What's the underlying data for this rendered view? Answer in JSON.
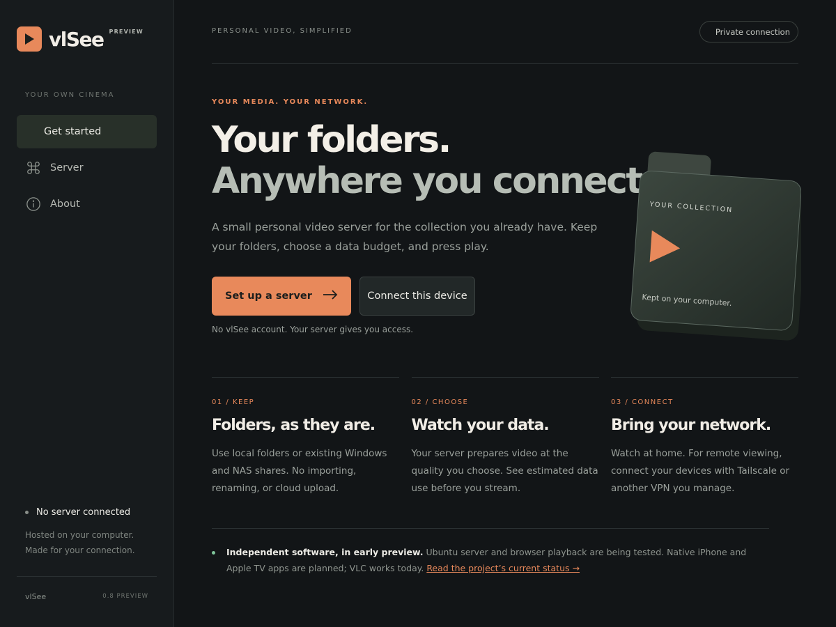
{
  "brand": {
    "name": "vlSee",
    "badge": "PREVIEW",
    "accent": "#e8895b"
  },
  "sidebar": {
    "section_label": "YOUR OWN CINEMA",
    "items": [
      {
        "label": "Get started",
        "icon": "none",
        "active": true
      },
      {
        "label": "Server",
        "icon": "command-icon",
        "active": false
      },
      {
        "label": "About",
        "icon": "info-icon",
        "active": false
      }
    ],
    "status": {
      "label": "No server connected",
      "line1": "Hosted on your computer.",
      "line2": "Made for your connection."
    },
    "footer": {
      "name": "vlSee",
      "version": "0.8 PREVIEW"
    }
  },
  "header": {
    "tagline": "PERSONAL VIDEO, SIMPLIFIED",
    "pill": "Private connection"
  },
  "hero": {
    "eyebrow": "YOUR MEDIA. YOUR NETWORK.",
    "headline_1": "Your folders.",
    "headline_2": "Anywhere you connect.",
    "lede": "A small personal video server for the collection you already have. Keep your folders, choose a data budget, and press play.",
    "primary_button": "Set up a server",
    "secondary_button": "Connect this device",
    "note": "No vlSee account. Your server gives you access."
  },
  "folder_card": {
    "title": "YOUR COLLECTION",
    "caption": "Kept on your computer."
  },
  "features": [
    {
      "number": "01 / KEEP",
      "title": "Folders, as they are.",
      "body": "Use local folders or existing Windows and NAS shares. No importing, renaming, or cloud upload."
    },
    {
      "number": "02 / CHOOSE",
      "title": "Watch your data.",
      "body": "Your server prepares video at the quality you choose. See estimated data use before you stream."
    },
    {
      "number": "03 / CONNECT",
      "title": "Bring your network.",
      "body": "Watch at home. For remote viewing, connect your devices with Tailscale or another VPN you manage."
    }
  ],
  "footer_note": {
    "strong": "Independent software, in early preview.",
    "text": " Ubuntu server and browser playback are being tested. Native iPhone and Apple TV apps are planned; VLC works today. ",
    "link": "Read the project’s current status →"
  }
}
